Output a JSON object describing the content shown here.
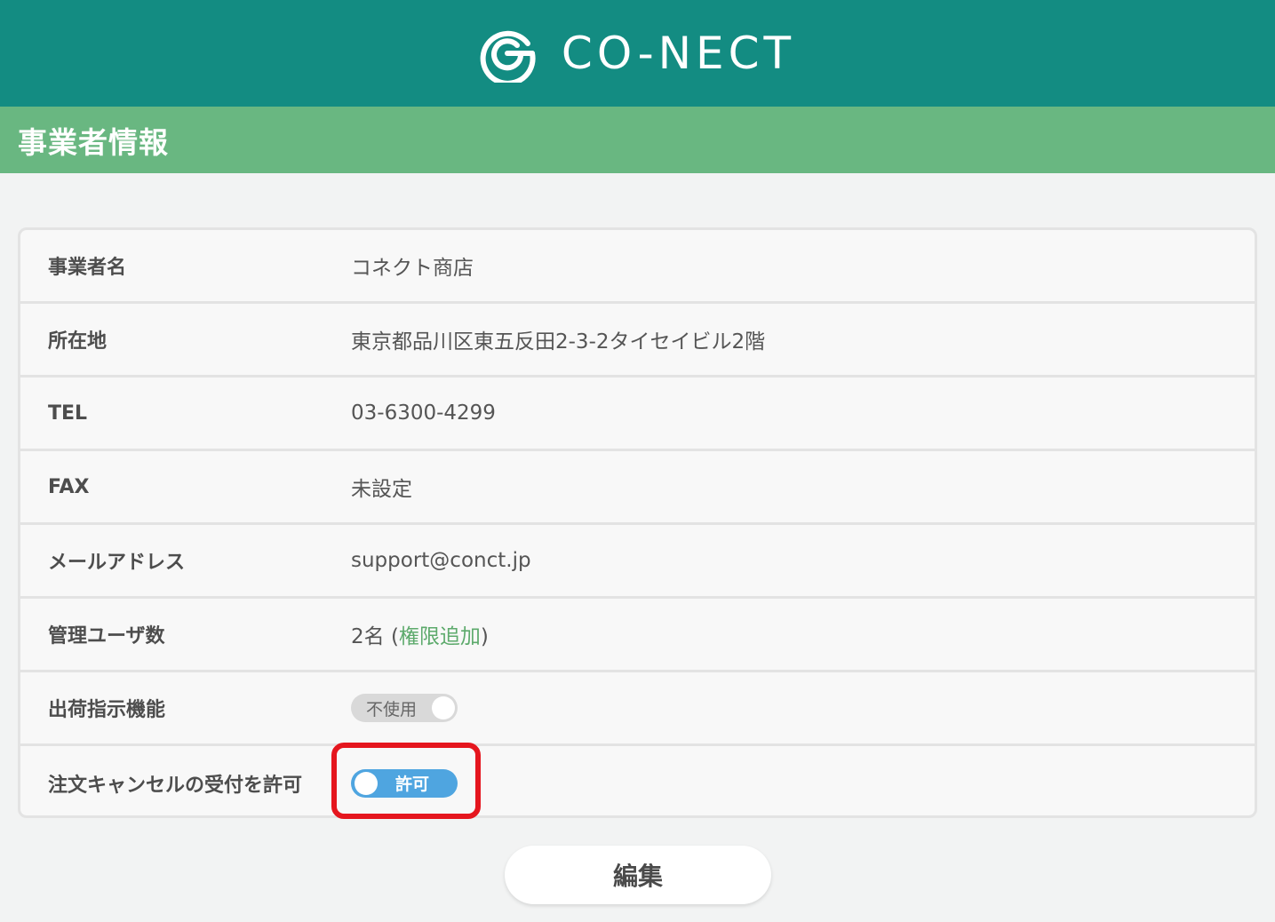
{
  "brand": {
    "name": "CO-NECT",
    "icon": "conect-logo-icon"
  },
  "page": {
    "title": "事業者情報"
  },
  "info": {
    "business_name": {
      "label": "事業者名",
      "value": "コネクト商店"
    },
    "address": {
      "label": "所在地",
      "value": "東京都品川区東五反田2-3-2タイセイビル2階"
    },
    "tel": {
      "label": "TEL",
      "value": "03-6300-4299"
    },
    "fax": {
      "label": "FAX",
      "value": "未設定"
    },
    "email": {
      "label": "メールアドレス",
      "value": "support@conct.jp"
    },
    "admin_users": {
      "label": "管理ユーザ数",
      "value": "2名 (",
      "link": "権限追加",
      "suffix": ")"
    },
    "shipping": {
      "label": "出荷指示機能",
      "toggle_text": "不使用",
      "enabled": false
    },
    "cancel": {
      "label": "注文キャンセルの受付を許可",
      "toggle_text": "許可",
      "enabled": true
    }
  },
  "actions": {
    "edit_label": "編集"
  },
  "colors": {
    "header": "#138c82",
    "subheader": "#69b781",
    "toggle_on": "#4fa5e0",
    "toggle_off": "#d9d9d9",
    "highlight": "#e5161e",
    "link": "#5daa6c"
  }
}
